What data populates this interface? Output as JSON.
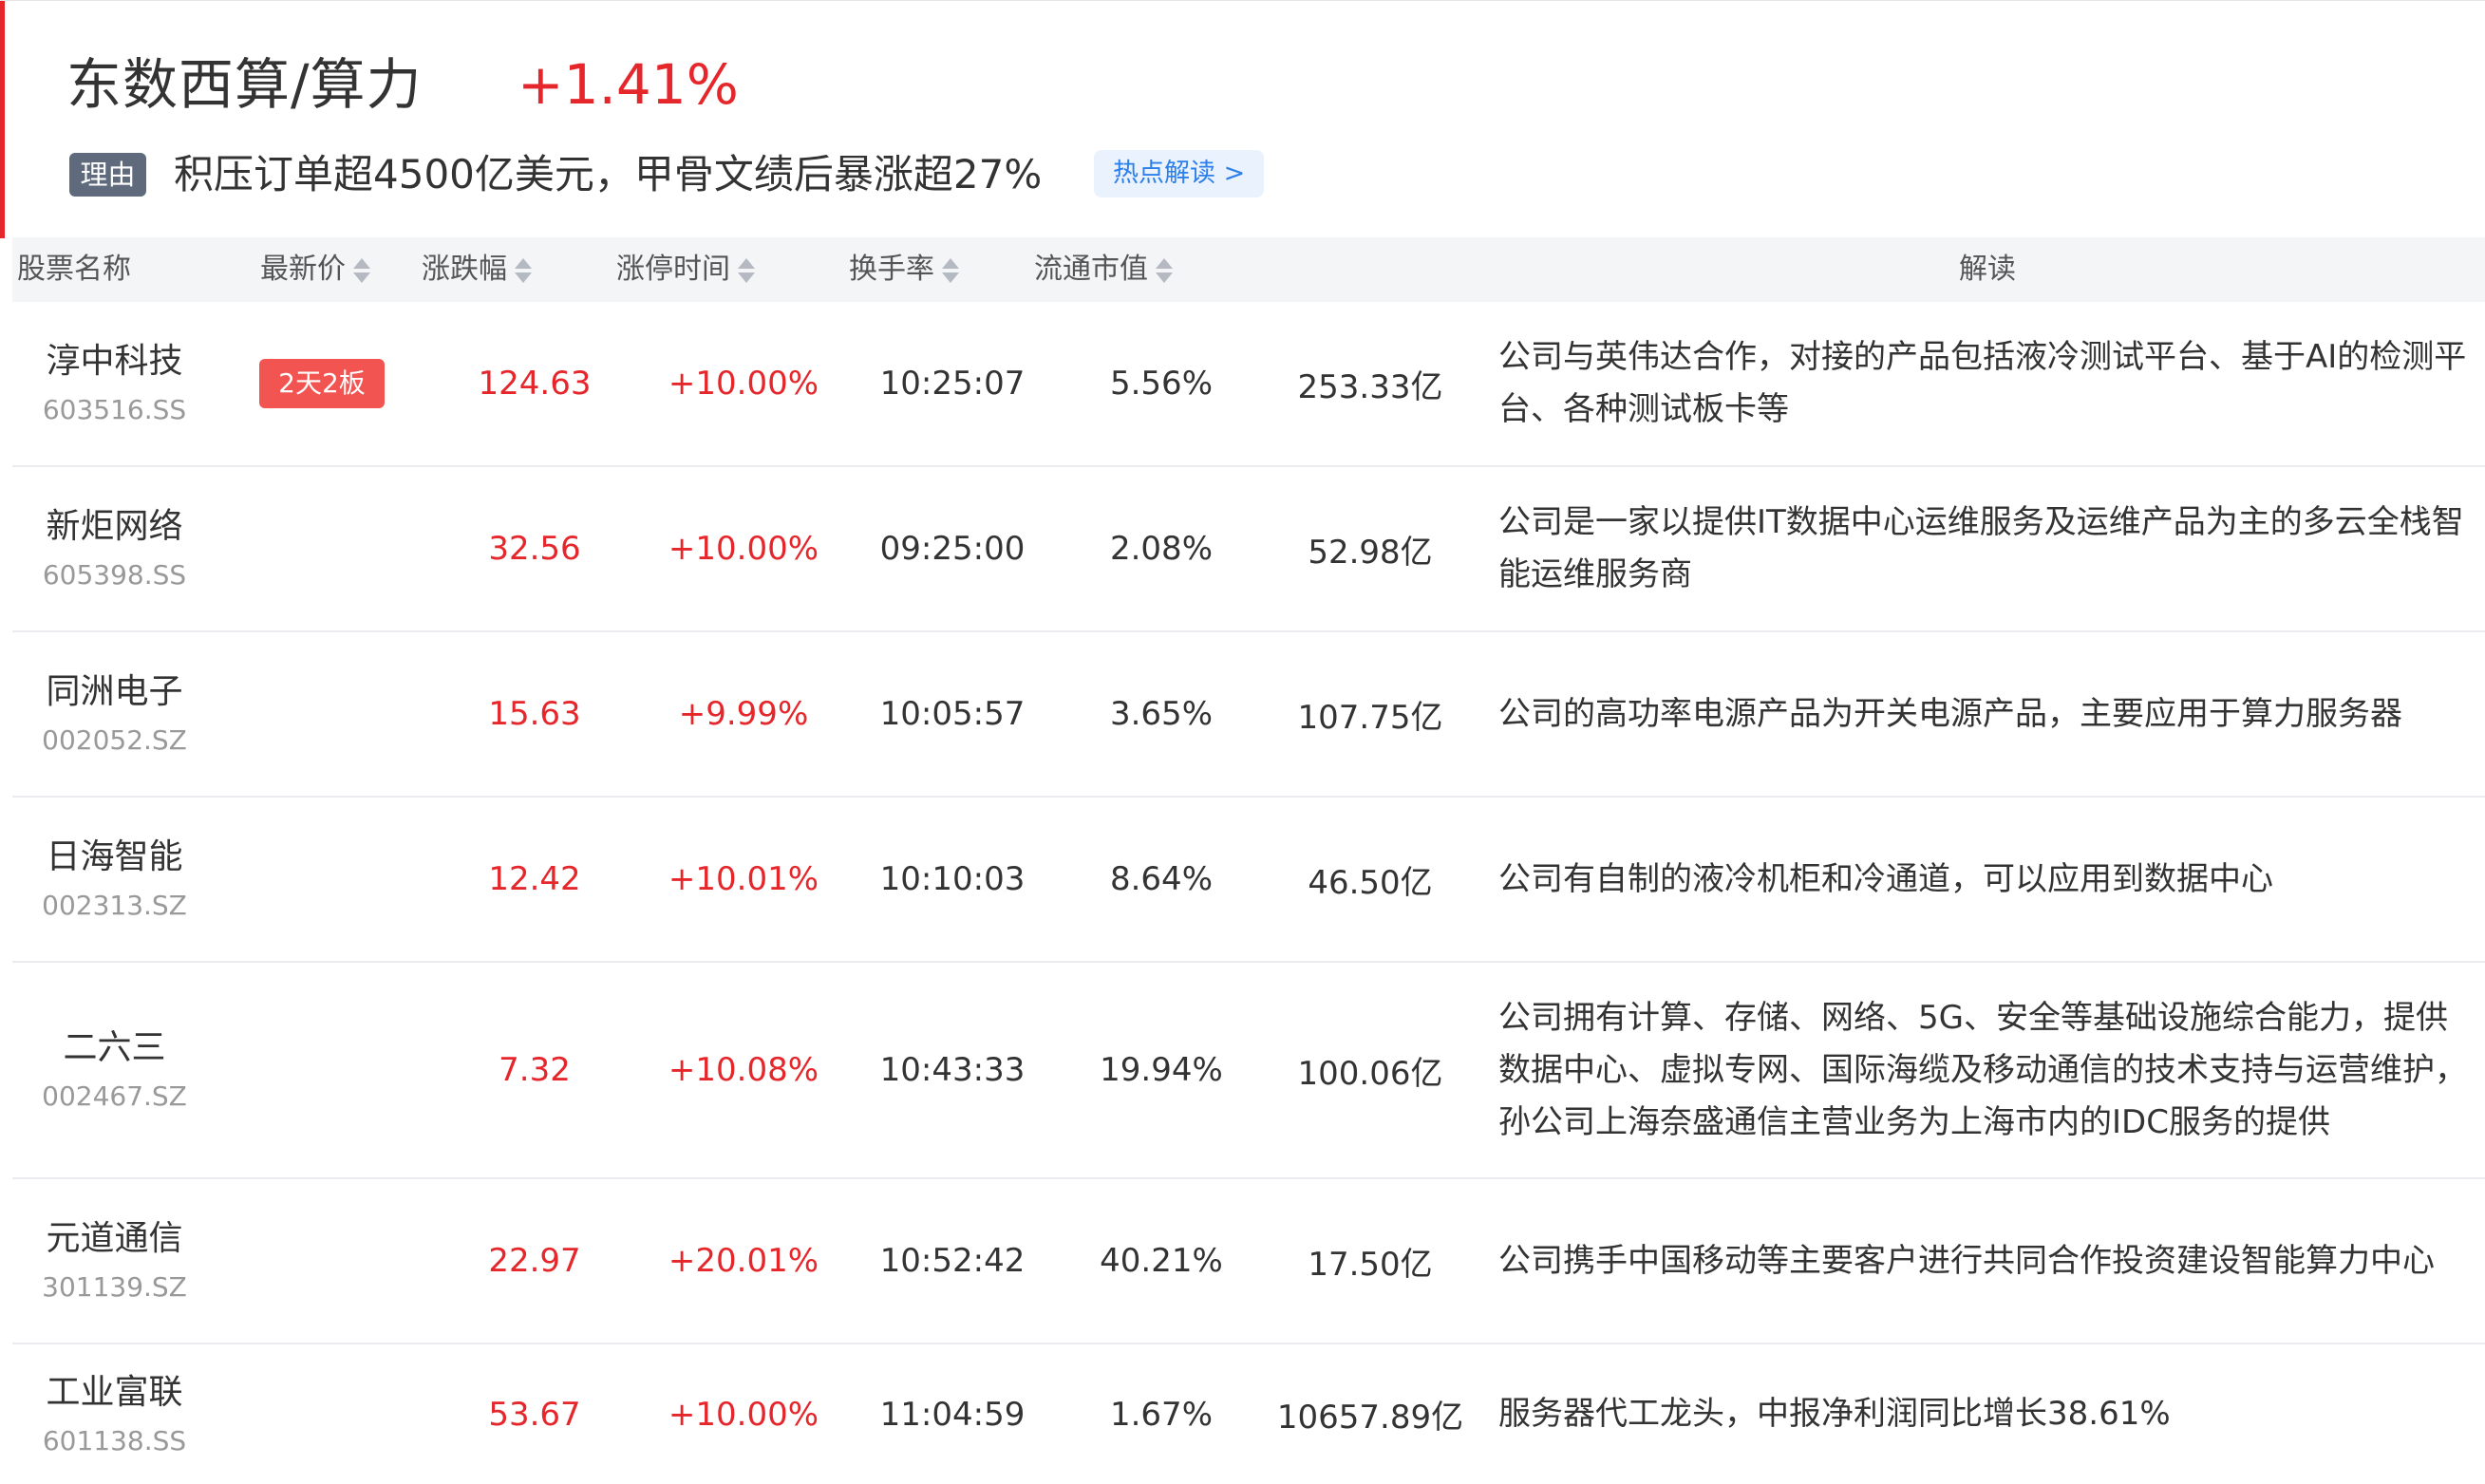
{
  "header": {
    "title": "东数西算/算力",
    "change": "+1.41%",
    "reason_tag": "理由",
    "reason_text": "积压订单超4500亿美元，甲骨文绩后暴涨超27%",
    "hot_link": "热点解读 >"
  },
  "colors": {
    "accent": "#e5262b",
    "link": "#2d7fe9",
    "badge": "#f25451",
    "tag": "#5f6b7d"
  },
  "columns": {
    "name": "股票名称",
    "price": "最新价",
    "change": "涨跌幅",
    "limit_time": "涨停时间",
    "turnover": "换手率",
    "float_cap": "流通市值",
    "interpretation": "解读"
  },
  "rows": [
    {
      "name": "淳中科技",
      "code": "603516.SS",
      "badge": "2天2板",
      "price": "124.63",
      "change": "+10.00%",
      "time": "10:25:07",
      "turnover": "5.56%",
      "cap": "253.33亿",
      "desc": "公司与英伟达合作，对接的产品包括液冷测试平台、基于AI的检测平台、各种测试板卡等"
    },
    {
      "name": "新炬网络",
      "code": "605398.SS",
      "badge": "",
      "price": "32.56",
      "change": "+10.00%",
      "time": "09:25:00",
      "turnover": "2.08%",
      "cap": "52.98亿",
      "desc": "公司是一家以提供IT数据中心运维服务及运维产品为主的多云全栈智能运维服务商"
    },
    {
      "name": "同洲电子",
      "code": "002052.SZ",
      "badge": "",
      "price": "15.63",
      "change": "+9.99%",
      "time": "10:05:57",
      "turnover": "3.65%",
      "cap": "107.75亿",
      "desc": "公司的高功率电源产品为开关电源产品，主要应用于算力服务器"
    },
    {
      "name": "日海智能",
      "code": "002313.SZ",
      "badge": "",
      "price": "12.42",
      "change": "+10.01%",
      "time": "10:10:03",
      "turnover": "8.64%",
      "cap": "46.50亿",
      "desc": "公司有自制的液冷机柜和冷通道，可以应用到数据中心"
    },
    {
      "name": "二六三",
      "code": "002467.SZ",
      "badge": "",
      "price": "7.32",
      "change": "+10.08%",
      "time": "10:43:33",
      "turnover": "19.94%",
      "cap": "100.06亿",
      "desc": "公司拥有计算、存储、网络、5G、安全等基础设施综合能力，提供数据中心、虚拟专网、国际海缆及移动通信的技术支持与运营维护，孙公司上海奈盛通信主营业务为上海市内的IDC服务的提供"
    },
    {
      "name": "元道通信",
      "code": "301139.SZ",
      "badge": "",
      "price": "22.97",
      "change": "+20.01%",
      "time": "10:52:42",
      "turnover": "40.21%",
      "cap": "17.50亿",
      "desc": "公司携手中国移动等主要客户进行共同合作投资建设智能算力中心"
    },
    {
      "name": "工业富联",
      "code": "601138.SS",
      "badge": "",
      "price": "53.67",
      "change": "+10.00%",
      "time": "11:04:59",
      "turnover": "1.67%",
      "cap": "10657.89亿",
      "desc": "服务器代工龙头，中报净利润同比增长38.61%"
    }
  ]
}
